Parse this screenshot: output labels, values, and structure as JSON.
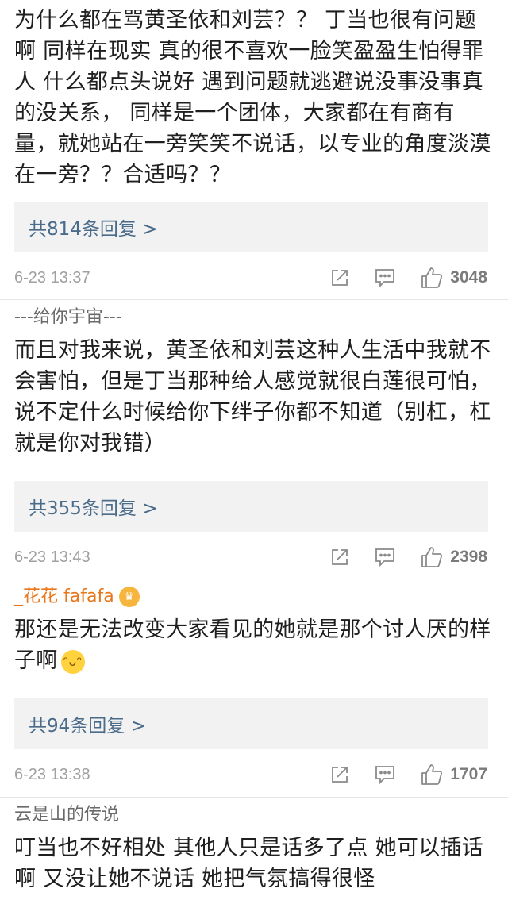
{
  "comments": [
    {
      "username": "",
      "text": "为什么都在骂黄圣依和刘芸？？ 丁当也很有问题啊 同样在现实 真的很不喜欢一脸笑盈盈生怕得罪人 什么都点头说好 遇到问题就逃避说没事没事真的没关系， 同样是一个团体，大家都在有商有量，就她站在一旁笑笑不说话，以专业的角度淡漠在一旁？？合适吗？？",
      "reply_label": "共814条回复 >",
      "time": "6-23 13:37",
      "likes": "3048"
    },
    {
      "username": "---给你宇宙---",
      "text": "而且对我来说，黄圣依和刘芸这种人生活中我就不会害怕，但是丁当那种给人感觉就很白莲很可怕，说不定什么时候给你下绊子你都不知道（别杠，杠就是你对我错）",
      "reply_label": "共355条回复 >",
      "time": "6-23 13:43",
      "likes": "2398"
    },
    {
      "username": "_花花 fafafa",
      "text": "那还是无法改变大家看见的她就是那个讨人厌的样子啊",
      "reply_label": "共94条回复 >",
      "time": "6-23 13:38",
      "likes": "1707"
    },
    {
      "username": "云是山的传说",
      "text": "叮当也不好相处 其他人只是话多了点 她可以插话啊 又没让她不说话 她把气氛搞得很怪"
    }
  ],
  "icons": {
    "share": "share-icon",
    "comment": "comment-icon",
    "like": "thumbs-up-icon",
    "crown": "crown-badge-icon",
    "emoji": "grinning-emoji-icon"
  },
  "colors": {
    "reply_link": "#4a6b8a",
    "username_vip": "#e8761a",
    "meta_gray": "#a0a0a0"
  }
}
